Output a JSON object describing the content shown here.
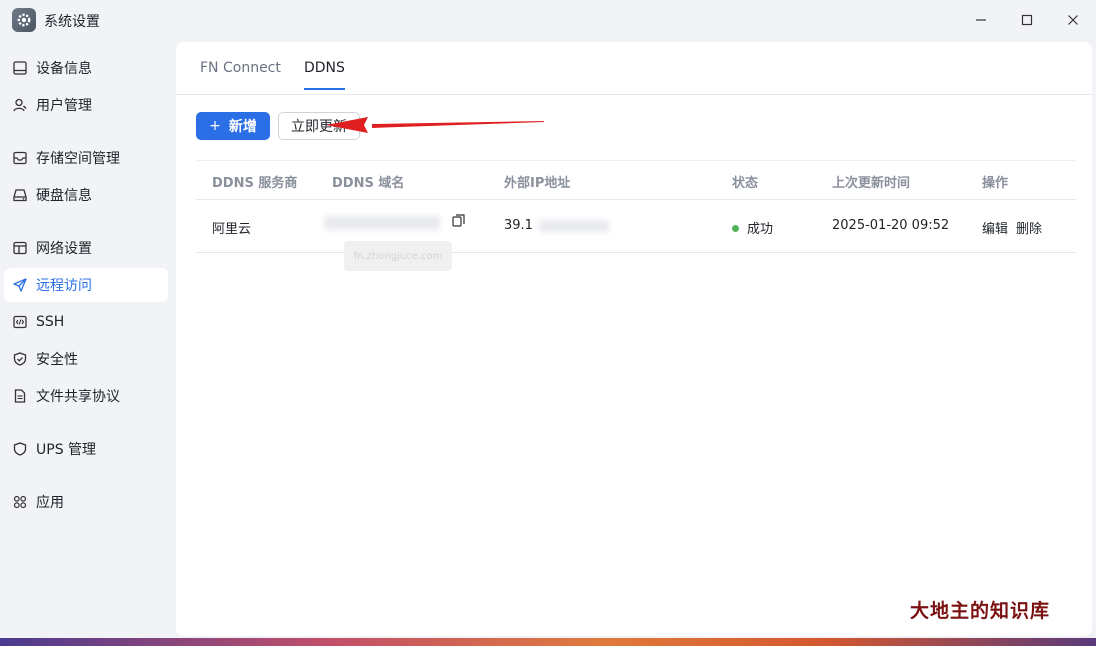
{
  "window": {
    "title": "系统设置"
  },
  "sidebar": {
    "items": [
      {
        "label": "设备信息",
        "icon": "device-icon"
      },
      {
        "label": "用户管理",
        "icon": "user-icon"
      },
      {
        "label": "存储空间管理",
        "icon": "storage-icon"
      },
      {
        "label": "硬盘信息",
        "icon": "disk-icon"
      },
      {
        "label": "网络设置",
        "icon": "network-icon"
      },
      {
        "label": "远程访问",
        "icon": "send-icon",
        "active": true
      },
      {
        "label": "SSH",
        "icon": "code-icon"
      },
      {
        "label": "安全性",
        "icon": "shield-check-icon"
      },
      {
        "label": "文件共享协议",
        "icon": "file-icon"
      },
      {
        "label": "UPS 管理",
        "icon": "shield-icon"
      },
      {
        "label": "应用",
        "icon": "apps-icon"
      }
    ]
  },
  "tabs": [
    {
      "label": "FN Connect",
      "active": false
    },
    {
      "label": "DDNS",
      "active": true
    }
  ],
  "toolbar": {
    "add_label": "新增",
    "update_label": "立即更新"
  },
  "table": {
    "headers": [
      "DDNS 服务商",
      "DDNS 域名",
      "外部IP地址",
      "状态",
      "上次更新时间",
      "操作"
    ],
    "rows": [
      {
        "provider": "阿里云",
        "domain": "",
        "ip": "39.1",
        "status": "成功",
        "updated": "2025-01-20 09:52",
        "actions": [
          "编辑",
          "删除"
        ]
      }
    ]
  },
  "tooltip": "fn.zhongjuce.com",
  "watermark": "大地主的知识库",
  "colors": {
    "accent": "#2b6fe6",
    "success": "#52b35a",
    "annotation_arrow": "#e02020",
    "watermark": "#7a1010"
  }
}
